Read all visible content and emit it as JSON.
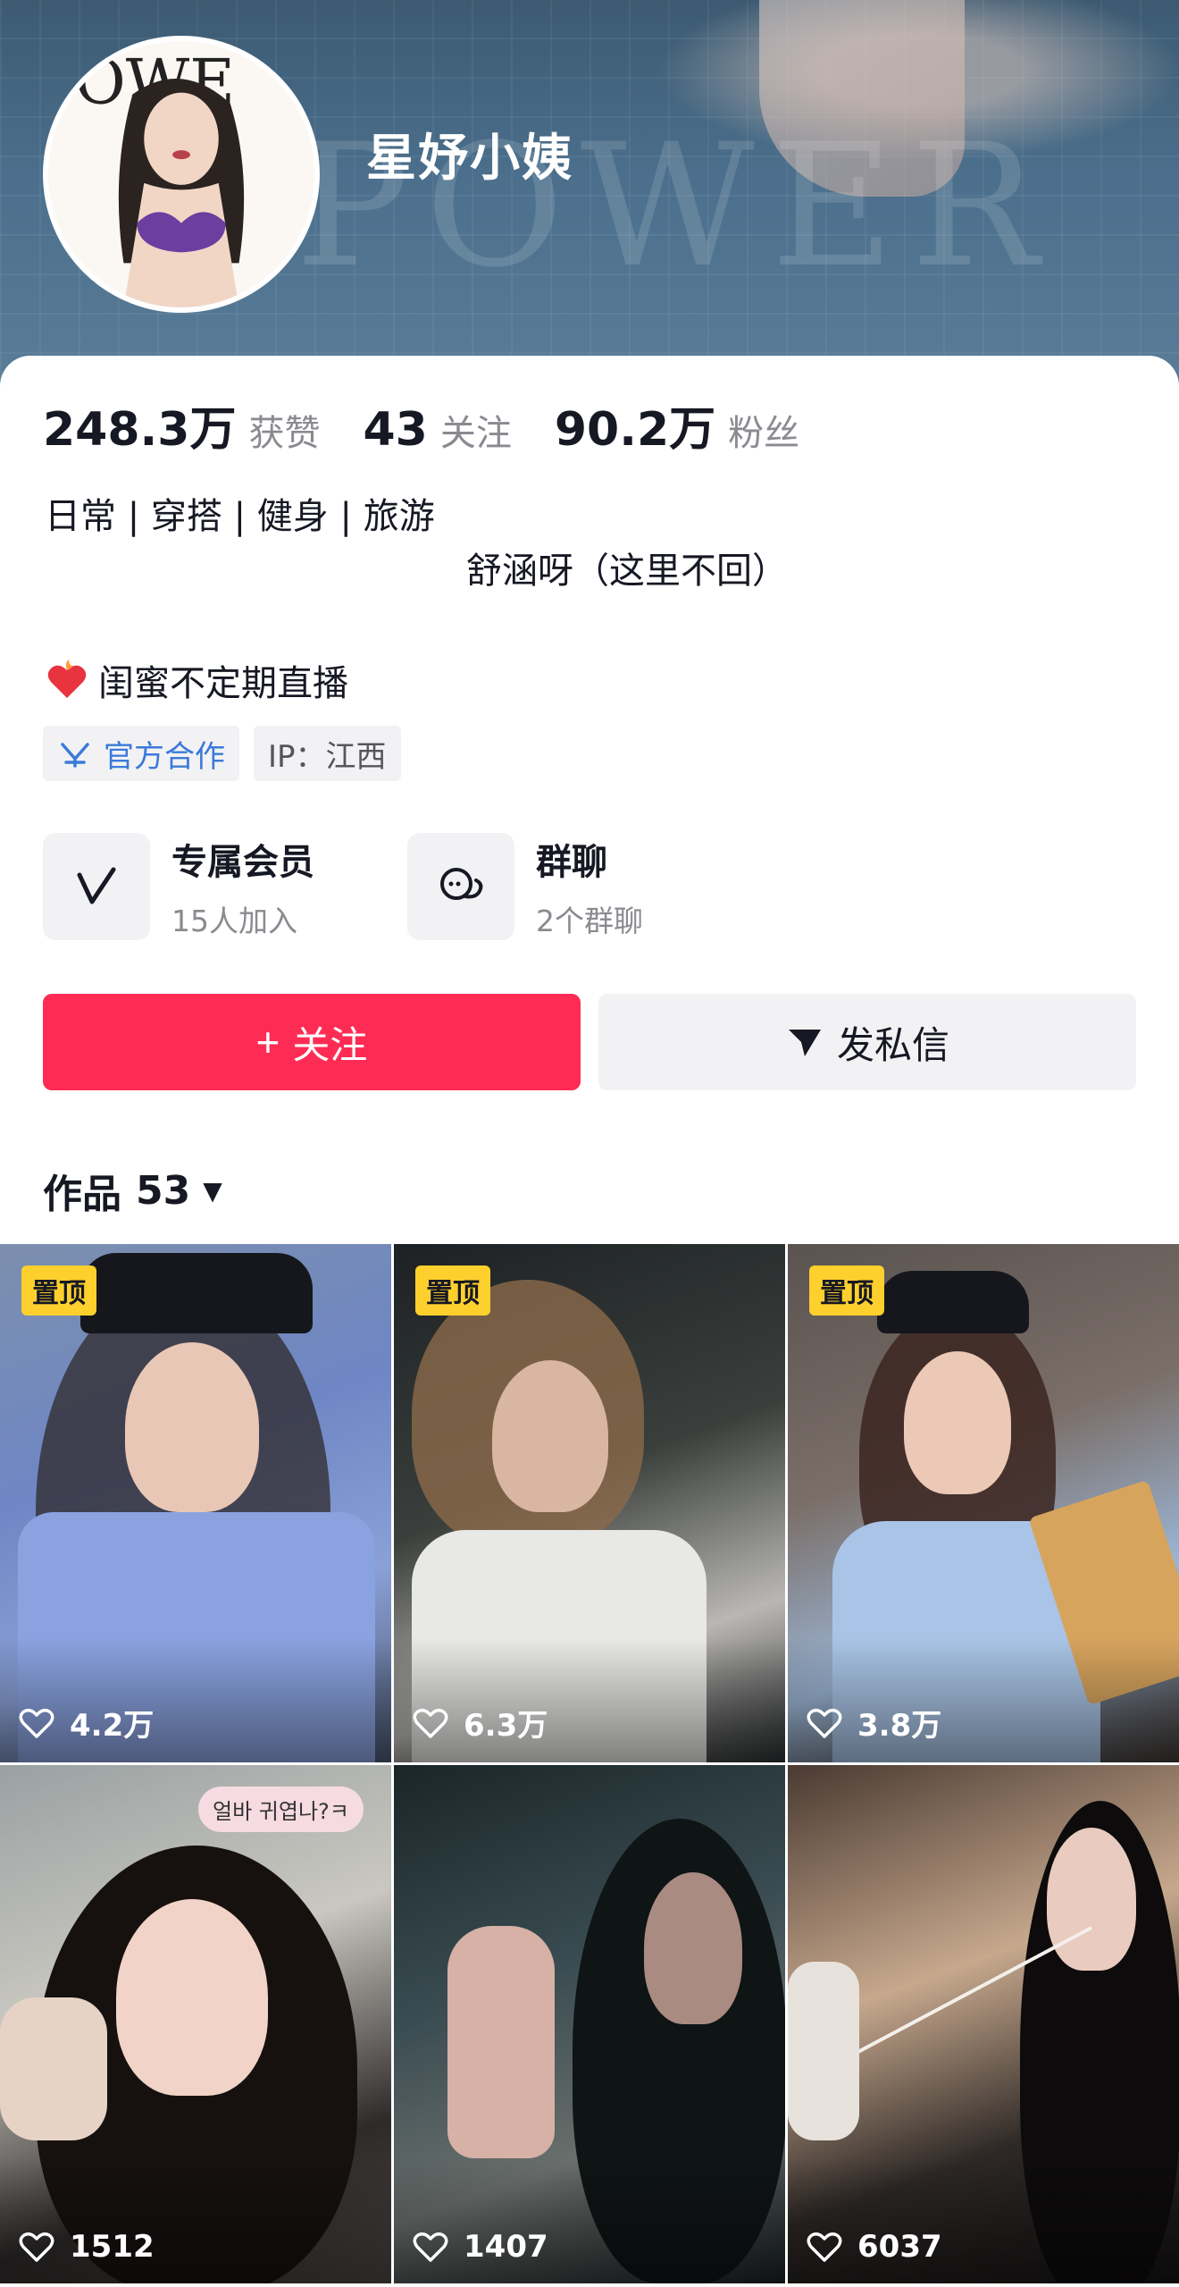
{
  "profile": {
    "username": "星妤小姨",
    "cover_text": "POWER",
    "avatar_text": "OWE"
  },
  "stats": [
    {
      "value": "248.3万",
      "label": "获赞"
    },
    {
      "value": "43",
      "label": "关注"
    },
    {
      "value": "90.2万",
      "label": "粉丝"
    }
  ],
  "bio": {
    "tags": "日常 | 穿搭 | 健身 | 旅游",
    "line2": "舒涵呀（这里不回）",
    "live": "闺蜜不定期直播"
  },
  "chips": {
    "official": "官方合作",
    "ip": "IP：江西"
  },
  "features": [
    {
      "title": "专属会员",
      "sub": "15人加入",
      "icon": "v-member-icon"
    },
    {
      "title": "群聊",
      "sub": "2个群聊",
      "icon": "chat-bubble-icon"
    }
  ],
  "actions": {
    "follow": "关注",
    "follow_icon": "+",
    "message": "发私信"
  },
  "works": {
    "label": "作品",
    "count": "53"
  },
  "videos": [
    {
      "pinned": true,
      "pin_label": "置顶",
      "likes": "4.2万"
    },
    {
      "pinned": true,
      "pin_label": "置顶",
      "likes": "6.3万"
    },
    {
      "pinned": true,
      "pin_label": "置顶",
      "likes": "3.8万"
    },
    {
      "pinned": false,
      "pin_label": "",
      "likes": "1512",
      "overlay_text": "얼바 귀엽나?ㅋ"
    },
    {
      "pinned": false,
      "pin_label": "",
      "likes": "1407"
    },
    {
      "pinned": false,
      "pin_label": "",
      "likes": "6037"
    }
  ],
  "colors": {
    "follow_button": "#fe2c55",
    "pin_badge": "#fdd02d",
    "official_chip_text": "#3b7ad9"
  }
}
